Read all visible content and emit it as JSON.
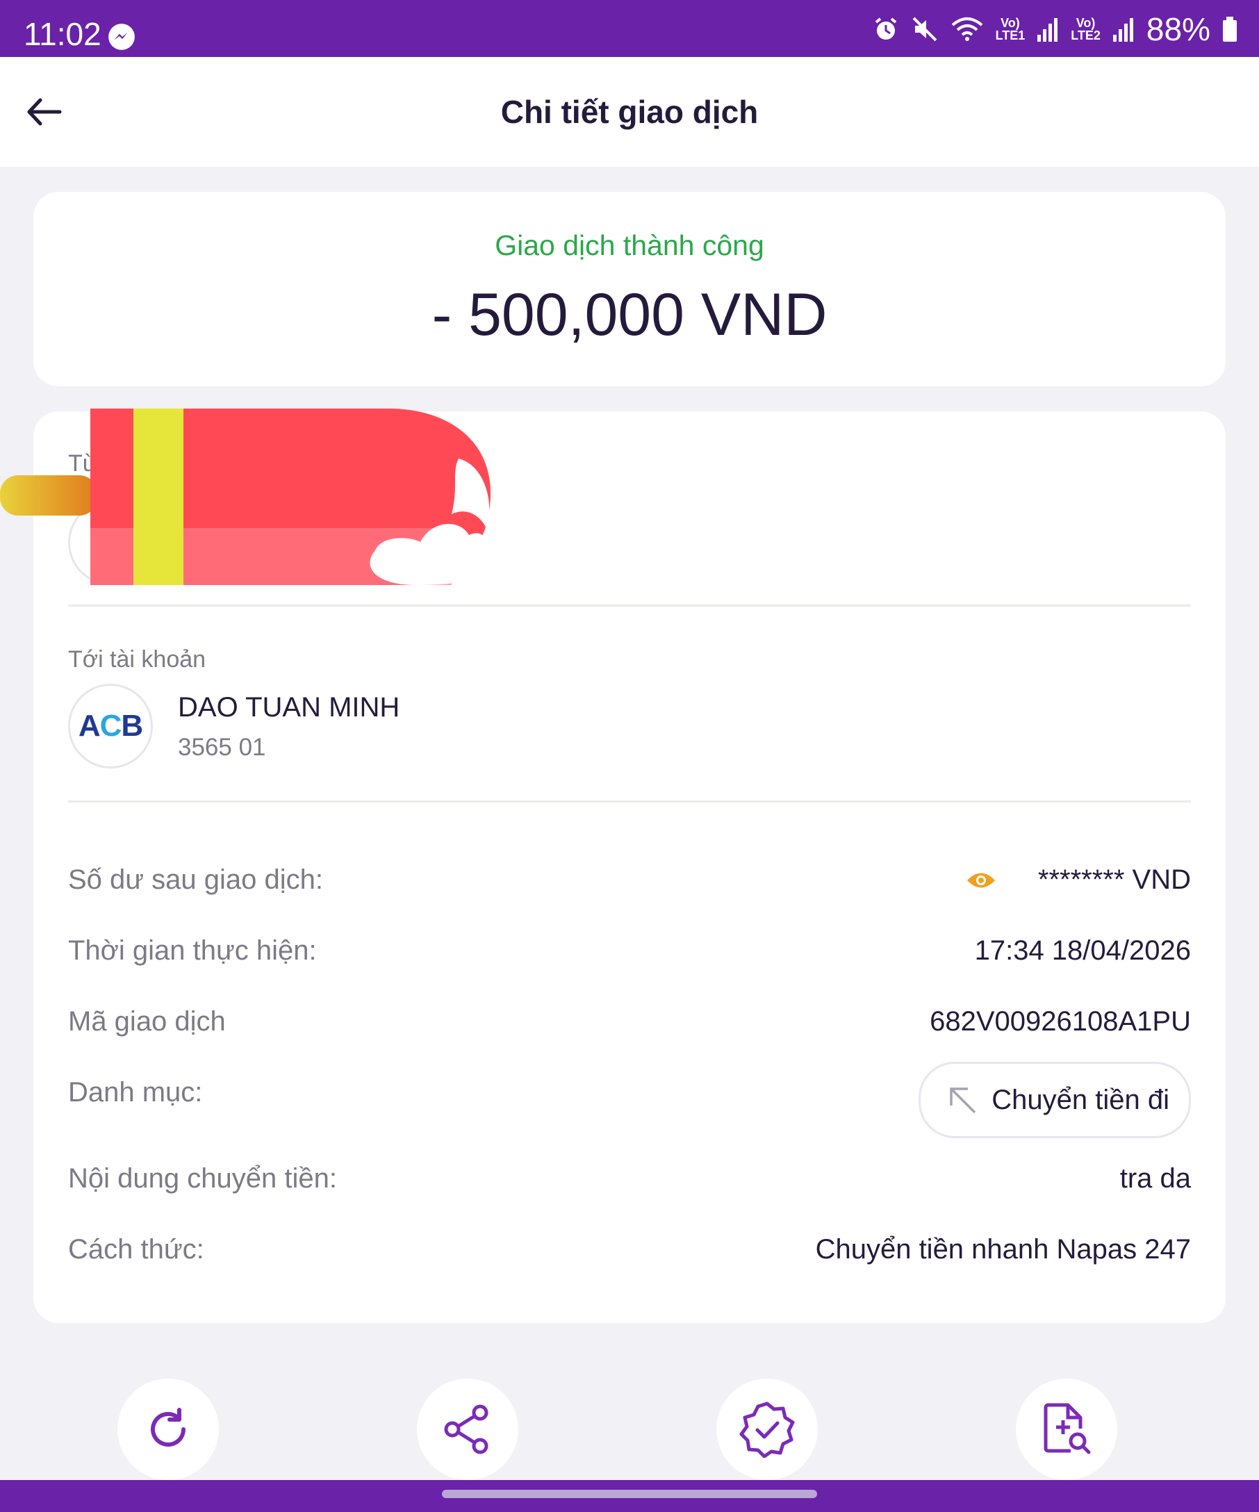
{
  "status_bar": {
    "time": "11:02",
    "battery": "88%",
    "sim1_top": "Vo)",
    "sim1_bottom": "LTE1",
    "sim2_top": "Vo)",
    "sim2_bottom": "LTE2",
    "icons": [
      "messenger-icon",
      "alarm-icon",
      "mute-icon",
      "wifi-icon",
      "signal-icon",
      "battery-icon"
    ]
  },
  "header": {
    "title": "Chi tiết giao dịch",
    "back_icon": "arrow-left-icon"
  },
  "summary": {
    "status": "Giao dịch thành công",
    "amount": "- 500,000 VND"
  },
  "from": {
    "label": "Từ"
  },
  "to": {
    "label": "Tới tài khoản",
    "bank_logo": "ACB",
    "name": "DAO TUAN MINH",
    "account": "3565 01"
  },
  "details": {
    "balance_label": "Số dư sau giao dịch:",
    "balance_value": "******** VND",
    "time_label": "Thời gian thực hiện:",
    "time_value": "17:34 18/04/2026",
    "code_label": "Mã giao dịch",
    "code_value": "682V00926108A1PU",
    "category_label": "Danh mục:",
    "category_value": "Chuyển tiền đi",
    "content_label": "Nội dung chuyển tiền:",
    "content_value": "tra da",
    "method_label": "Cách thức:",
    "method_value": "Chuyển tiền nhanh Napas 247"
  },
  "actions": [
    "refresh-icon",
    "share-icon",
    "verified-badge-icon",
    "document-search-icon"
  ],
  "colors": {
    "brand": "#6a22a8",
    "success": "#2aa84a",
    "accent": "#f0a020",
    "text": "#241b3c",
    "muted": "#7b7a86"
  }
}
